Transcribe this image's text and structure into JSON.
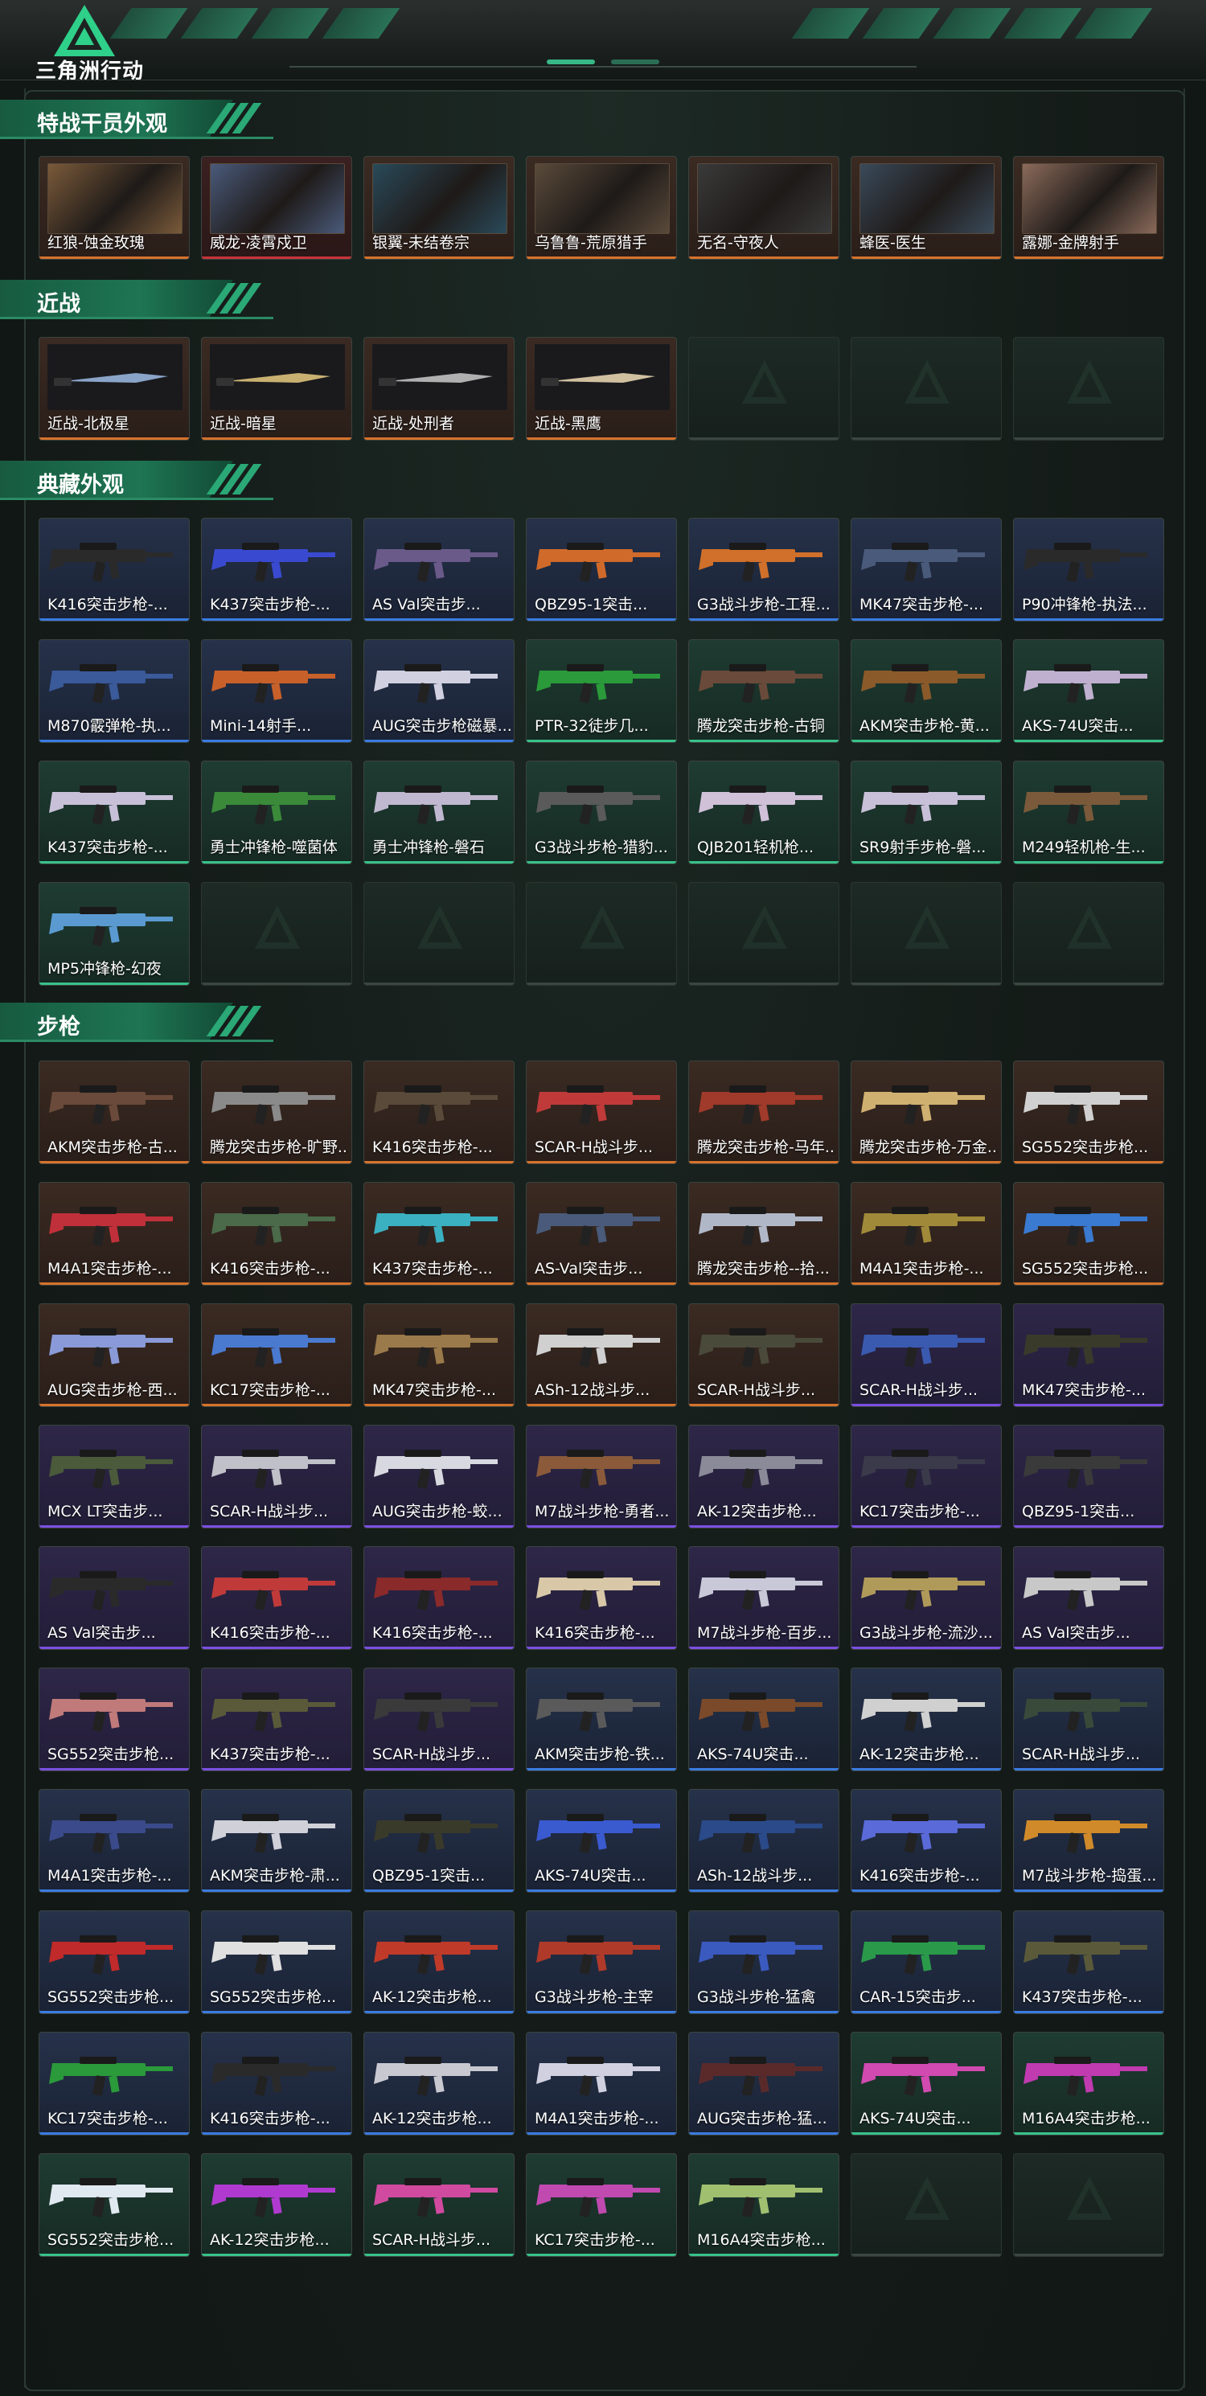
{
  "logo_text": "三角洲行动",
  "sections": [
    {
      "title": "特战干员外观",
      "items": [
        {
          "name": "红狼-蚀金玫瑰",
          "style": "brown orange-r",
          "kind": "portrait",
          "tint": "#7a5a3a"
        },
        {
          "name": "威龙-凌霄戍卫",
          "style": "red red-r",
          "kind": "portrait",
          "tint": "#4a5a7a"
        },
        {
          "name": "银翼-未结卷宗",
          "style": "brown orange-r",
          "kind": "portrait",
          "tint": "#2a4a5a"
        },
        {
          "name": "乌鲁鲁-荒原猎手",
          "style": "brown orange-r",
          "kind": "portrait",
          "tint": "#5a4a3a"
        },
        {
          "name": "无名-守夜人",
          "style": "brown orange-r",
          "kind": "portrait",
          "tint": "#3a3a3a"
        },
        {
          "name": "蜂医-医生",
          "style": "brown orange-r",
          "kind": "portrait",
          "tint": "#3a4a5a"
        },
        {
          "name": "露娜-金牌射手",
          "style": "brown orange-r",
          "kind": "portrait",
          "tint": "#8a6a5a"
        }
      ]
    },
    {
      "title": "近战",
      "items": [
        {
          "name": "近战-北极星",
          "style": "brown orange-r",
          "kind": "knife",
          "gun": "#8aa4c8"
        },
        {
          "name": "近战-暗星",
          "style": "brown orange-r",
          "kind": "knife",
          "gun": "#c8b070"
        },
        {
          "name": "近战-处刑者",
          "style": "brown orange-r",
          "kind": "knife",
          "gun": "#b0b0b0"
        },
        {
          "name": "近战-黑鹰",
          "style": "brown orange-r",
          "kind": "knife",
          "gun": "#d0c0a0"
        },
        {
          "name": "",
          "style": "empty",
          "kind": "empty"
        },
        {
          "name": "",
          "style": "empty",
          "kind": "empty"
        },
        {
          "name": "",
          "style": "empty",
          "kind": "empty"
        }
      ]
    },
    {
      "title": "典藏外观",
      "items": [
        {
          "name": "K416突击步枪-...",
          "style": "blue blue-r",
          "kind": "gun",
          "gun": "#2a2a2a"
        },
        {
          "name": "K437突击步枪-...",
          "style": "blue blue-r",
          "kind": "gun",
          "gun": "#3a4ad0"
        },
        {
          "name": "AS Val突击步...",
          "style": "blue blue-r",
          "kind": "gun",
          "gun": "#6a5a8a"
        },
        {
          "name": "QBZ95-1突击...",
          "style": "blue blue-r",
          "kind": "gun",
          "gun": "#d06a2a"
        },
        {
          "name": "G3战斗步枪-工程...",
          "style": "blue blue-r",
          "kind": "gun",
          "gun": "#d0702a"
        },
        {
          "name": "MK47突击步枪-...",
          "style": "blue blue-r",
          "kind": "gun",
          "gun": "#4a5a7a"
        },
        {
          "name": "P90冲锋枪-执法...",
          "style": "blue blue-r",
          "kind": "gun",
          "gun": "#2a2a2a"
        },
        {
          "name": "M870霰弹枪-执...",
          "style": "blue blue-r",
          "kind": "gun",
          "gun": "#3a5a9a"
        },
        {
          "name": "Mini-14射手...",
          "style": "blue blue-r",
          "kind": "gun",
          "gun": "#c8602a"
        },
        {
          "name": "AUG突击步枪磁暴...",
          "style": "blue blue-r",
          "kind": "gun",
          "gun": "#d0d0e0"
        },
        {
          "name": "PTR-32徒步几...",
          "style": "green green-r",
          "kind": "gun",
          "gun": "#2a9a3a"
        },
        {
          "name": "腾龙突击步枪-古铜",
          "style": "green green-r",
          "kind": "gun",
          "gun": "#6a4a3a"
        },
        {
          "name": "AKM突击步枪-黄...",
          "style": "green green-r",
          "kind": "gun",
          "gun": "#8a5a2a"
        },
        {
          "name": "AKS-74U突击...",
          "style": "green green-r",
          "kind": "gun",
          "gun": "#c0b0d0"
        },
        {
          "name": "K437突击步枪-...",
          "style": "green green-r",
          "kind": "gun",
          "gun": "#c8c0d8"
        },
        {
          "name": "勇士冲锋枪-噬菌体",
          "style": "green green-r",
          "kind": "gun",
          "gun": "#3a8a3a"
        },
        {
          "name": "勇士冲锋枪-磐石",
          "style": "green green-r",
          "kind": "gun",
          "gun": "#c0b8d0"
        },
        {
          "name": "G3战斗步枪-猎豹...",
          "style": "green green-r",
          "kind": "gun",
          "gun": "#5a5a5a"
        },
        {
          "name": "QJB201轻机枪...",
          "style": "green green-r",
          "kind": "gun",
          "gun": "#d0c0d8"
        },
        {
          "name": "SR9射手步枪-磐...",
          "style": "green green-r",
          "kind": "gun",
          "gun": "#c8c0d8"
        },
        {
          "name": "M249轻机枪-生...",
          "style": "green green-r",
          "kind": "gun",
          "gun": "#7a5a3a"
        },
        {
          "name": "MP5冲锋枪-幻夜",
          "style": "green green-r",
          "kind": "gun",
          "gun": "#5a9ad0"
        },
        {
          "name": "",
          "style": "empty",
          "kind": "empty"
        },
        {
          "name": "",
          "style": "empty",
          "kind": "empty"
        },
        {
          "name": "",
          "style": "empty",
          "kind": "empty"
        },
        {
          "name": "",
          "style": "empty",
          "kind": "empty"
        },
        {
          "name": "",
          "style": "empty",
          "kind": "empty"
        },
        {
          "name": "",
          "style": "empty",
          "kind": "empty"
        }
      ]
    },
    {
      "title": "步枪",
      "items": [
        {
          "name": "AKM突击步枪-古...",
          "style": "brown orange-r",
          "kind": "gun",
          "gun": "#6a4a3a"
        },
        {
          "name": "腾龙突击步枪-旷野...",
          "style": "brown orange-r",
          "kind": "gun",
          "gun": "#8a8a8a"
        },
        {
          "name": "K416突击步枪-...",
          "style": "brown orange-r",
          "kind": "gun",
          "gun": "#5a4a3a"
        },
        {
          "name": "SCAR-H战斗步...",
          "style": "brown orange-r",
          "kind": "gun",
          "gun": "#c03a3a"
        },
        {
          "name": "腾龙突击步枪-马年...",
          "style": "brown orange-r",
          "kind": "gun",
          "gun": "#a03a2a"
        },
        {
          "name": "腾龙突击步枪-万金...",
          "style": "brown orange-r",
          "kind": "gun",
          "gun": "#d0b070"
        },
        {
          "name": "SG552突击步枪...",
          "style": "brown orange-r",
          "kind": "gun",
          "gun": "#d0d0d0"
        },
        {
          "name": "M4A1突击步枪-...",
          "style": "brown orange-r",
          "kind": "gun",
          "gun": "#c0303a"
        },
        {
          "name": "K416突击步枪-...",
          "style": "brown orange-r",
          "kind": "gun",
          "gun": "#4a6a4a"
        },
        {
          "name": "K437突击步枪-...",
          "style": "brown orange-r",
          "kind": "gun",
          "gun": "#3ab0c0"
        },
        {
          "name": "AS-Val突击步...",
          "style": "brown orange-r",
          "kind": "gun",
          "gun": "#4a5a7a"
        },
        {
          "name": "腾龙突击步枪--拾...",
          "style": "brown orange-r",
          "kind": "gun",
          "gun": "#b0b8c8"
        },
        {
          "name": "M4A1突击步枪-...",
          "style": "brown orange-r",
          "kind": "gun",
          "gun": "#a08a3a"
        },
        {
          "name": "SG552突击步枪...",
          "style": "brown orange-r",
          "kind": "gun",
          "gun": "#3a7ad0"
        },
        {
          "name": "AUG突击步枪-西...",
          "style": "brown orange-r",
          "kind": "gun",
          "gun": "#8a9ad8"
        },
        {
          "name": "KC17突击步枪-...",
          "style": "brown orange-r",
          "kind": "gun",
          "gun": "#4a7ad0"
        },
        {
          "name": "MK47突击步枪-...",
          "style": "brown orange-r",
          "kind": "gun",
          "gun": "#9a7a4a"
        },
        {
          "name": "ASh-12战斗步...",
          "style": "brown orange-r",
          "kind": "gun",
          "gun": "#d0d0d0"
        },
        {
          "name": "SCAR-H战斗步...",
          "style": "brown orange-r",
          "kind": "gun",
          "gun": "#4a4a3a"
        },
        {
          "name": "SCAR-H战斗步...",
          "style": "purple purple-r",
          "kind": "gun",
          "gun": "#3a5ab0"
        },
        {
          "name": "MK47突击步枪-...",
          "style": "purple purple-r",
          "kind": "gun",
          "gun": "#3a3a2a"
        },
        {
          "name": "MCX LT突击步...",
          "style": "purple purple-r",
          "kind": "gun",
          "gun": "#4a5a3a"
        },
        {
          "name": "SCAR-H战斗步...",
          "style": "purple purple-r",
          "kind": "gun",
          "gun": "#c0c0c8"
        },
        {
          "name": "AUG突击步枪-蛟...",
          "style": "purple purple-r",
          "kind": "gun",
          "gun": "#d8d8e0"
        },
        {
          "name": "M7战斗步枪-勇者...",
          "style": "purple purple-r",
          "kind": "gun",
          "gun": "#8a5a3a"
        },
        {
          "name": "AK-12突击步枪...",
          "style": "purple purple-r",
          "kind": "gun",
          "gun": "#8a8a98"
        },
        {
          "name": "KC17突击步枪-...",
          "style": "purple purple-r",
          "kind": "gun",
          "gun": "#3a3a4a"
        },
        {
          "name": "QBZ95-1突击...",
          "style": "purple purple-r",
          "kind": "gun",
          "gun": "#3a3a3a"
        },
        {
          "name": "AS Val突击步...",
          "style": "purple purple-r",
          "kind": "gun",
          "gun": "#2a2a2a"
        },
        {
          "name": "K416突击步枪-...",
          "style": "purple purple-r",
          "kind": "gun",
          "gun": "#c03a3a"
        },
        {
          "name": "K416突击步枪-...",
          "style": "purple purple-r",
          "kind": "gun",
          "gun": "#8a2a2a"
        },
        {
          "name": "K416突击步枪-...",
          "style": "purple purple-r",
          "kind": "gun",
          "gun": "#d8c8a8"
        },
        {
          "name": "M7战斗步枪-百步...",
          "style": "purple purple-r",
          "kind": "gun",
          "gun": "#c8c8d8"
        },
        {
          "name": "G3战斗步枪-流沙...",
          "style": "purple purple-r",
          "kind": "gun",
          "gun": "#b09a5a"
        },
        {
          "name": "AS Val突击步...",
          "style": "purple purple-r",
          "kind": "gun",
          "gun": "#c8c8c8"
        },
        {
          "name": "SG552突击步枪...",
          "style": "purple purple-r",
          "kind": "gun",
          "gun": "#c07a7a"
        },
        {
          "name": "K437突击步枪-...",
          "style": "purple purple-r",
          "kind": "gun",
          "gun": "#5a5a3a"
        },
        {
          "name": "SCAR-H战斗步...",
          "style": "purple purple-r",
          "kind": "gun",
          "gun": "#3a3a3a"
        },
        {
          "name": "AKM突击步枪-铁...",
          "style": "blue blue-r",
          "kind": "gun",
          "gun": "#5a5a5a"
        },
        {
          "name": "AKS-74U突击...",
          "style": "blue blue-r",
          "kind": "gun",
          "gun": "#7a4a2a"
        },
        {
          "name": "AK-12突击步枪...",
          "style": "blue blue-r",
          "kind": "gun",
          "gun": "#d0d0d0"
        },
        {
          "name": "SCAR-H战斗步...",
          "style": "blue blue-r",
          "kind": "gun",
          "gun": "#3a4a3a"
        },
        {
          "name": "M4A1突击步枪-...",
          "style": "blue blue-r",
          "kind": "gun",
          "gun": "#3a4a8a"
        },
        {
          "name": "AKM突击步枪-肃...",
          "style": "blue blue-r",
          "kind": "gun",
          "gun": "#d0d0d8"
        },
        {
          "name": "QBZ95-1突击...",
          "style": "blue blue-r",
          "kind": "gun",
          "gun": "#3a3a2a"
        },
        {
          "name": "AKS-74U突击...",
          "style": "blue blue-r",
          "kind": "gun",
          "gun": "#3a5ad0"
        },
        {
          "name": "ASh-12战斗步...",
          "style": "blue blue-r",
          "kind": "gun",
          "gun": "#2a4a8a"
        },
        {
          "name": "K416突击步枪-...",
          "style": "blue blue-r",
          "kind": "gun",
          "gun": "#5a6ad8"
        },
        {
          "name": "M7战斗步枪-捣蛋...",
          "style": "blue blue-r",
          "kind": "gun",
          "gun": "#d08a2a"
        },
        {
          "name": "SG552突击步枪...",
          "style": "blue blue-r",
          "kind": "gun",
          "gun": "#c02a2a"
        },
        {
          "name": "SG552突击步枪...",
          "style": "blue blue-r",
          "kind": "gun",
          "gun": "#e0e0e0"
        },
        {
          "name": "AK-12突击步枪...",
          "style": "blue blue-r",
          "kind": "gun",
          "gun": "#c03a2a"
        },
        {
          "name": "G3战斗步枪-主宰",
          "style": "blue blue-r",
          "kind": "gun",
          "gun": "#b03a2a"
        },
        {
          "name": "G3战斗步枪-猛禽",
          "style": "blue blue-r",
          "kind": "gun",
          "gun": "#3a5ac0"
        },
        {
          "name": "CAR-15突击步...",
          "style": "blue blue-r",
          "kind": "gun",
          "gun": "#2a9a4a"
        },
        {
          "name": "K437突击步枪-...",
          "style": "blue blue-r",
          "kind": "gun",
          "gun": "#5a5a3a"
        },
        {
          "name": "KC17突击步枪-...",
          "style": "blue blue-r",
          "kind": "gun",
          "gun": "#2a9a3a"
        },
        {
          "name": "K416突击步枪-...",
          "style": "blue blue-r",
          "kind": "gun",
          "gun": "#2a2a2a"
        },
        {
          "name": "AK-12突击步枪...",
          "style": "blue blue-r",
          "kind": "gun",
          "gun": "#c8c8d0"
        },
        {
          "name": "M4A1突击步枪-...",
          "style": "blue blue-r",
          "kind": "gun",
          "gun": "#d0d0e0"
        },
        {
          "name": "AUG突击步枪-猛...",
          "style": "blue blue-r",
          "kind": "gun",
          "gun": "#5a2a2a"
        },
        {
          "name": "AKS-74U突击...",
          "style": "green green-r",
          "kind": "gun",
          "gun": "#d04ab0"
        },
        {
          "name": "M16A4突击步枪...",
          "style": "green green-r",
          "kind": "gun",
          "gun": "#c03ab0"
        },
        {
          "name": "SG552突击步枪...",
          "style": "green green-r",
          "kind": "gun",
          "gun": "#e0e8f0"
        },
        {
          "name": "AK-12突击步枪...",
          "style": "green green-r",
          "kind": "gun",
          "gun": "#b03ad0"
        },
        {
          "name": "SCAR-H战斗步...",
          "style": "green green-r",
          "kind": "gun",
          "gun": "#d04aa0"
        },
        {
          "name": "KC17突击步枪-...",
          "style": "green green-r",
          "kind": "gun",
          "gun": "#c04ab0"
        },
        {
          "name": "M16A4突击步枪...",
          "style": "green green-r",
          "kind": "gun",
          "gun": "#a0c070"
        },
        {
          "name": "",
          "style": "empty",
          "kind": "empty"
        },
        {
          "name": "",
          "style": "empty",
          "kind": "empty"
        }
      ]
    }
  ]
}
